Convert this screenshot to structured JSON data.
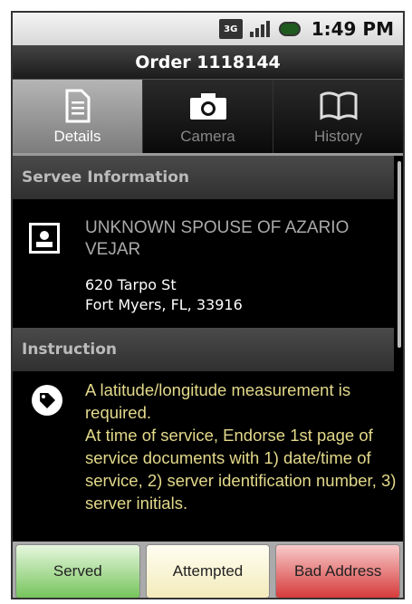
{
  "status_bar": {
    "network": "3G",
    "time": "1:49 PM",
    "icons": [
      "network-3g-icon",
      "signal-icon",
      "battery-charging-icon"
    ]
  },
  "header": {
    "title": "Order 1118144"
  },
  "tabs": [
    {
      "label": "Details",
      "icon": "document-icon",
      "active": true
    },
    {
      "label": "Camera",
      "icon": "camera-icon",
      "active": false
    },
    {
      "label": "History",
      "icon": "book-icon",
      "active": false
    }
  ],
  "servee": {
    "section_title": "Servee Information",
    "icon": "contact-icon",
    "name": "UNKNOWN SPOUSE OF AZARIO VEJAR",
    "address_line1": "620 Tarpo St",
    "address_line2": "Fort Myers, FL, 33916"
  },
  "instruction": {
    "section_title": "Instruction",
    "icon": "tag-icon",
    "text": "A latitude/longitude measurement is required.\nAt time of service, Endorse 1st page of service documents with 1) date/time of service, 2) server identification number, 3) server initials."
  },
  "actions": {
    "served": "Served",
    "attempted": "Attempted",
    "bad_address": "Bad Address"
  },
  "colors": {
    "served": "#76c45c",
    "attempted": "#f3ebbb",
    "bad_address": "#d63b3b",
    "instruction_text": "#e3d98a"
  }
}
